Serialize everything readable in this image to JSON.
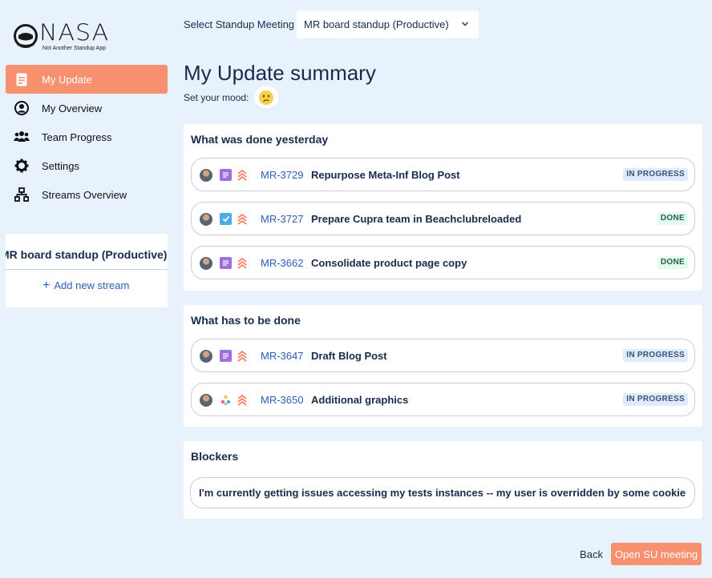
{
  "app": {
    "logo_text": "NASA",
    "logo_tagline": "Not Another Standup App"
  },
  "sidebar": {
    "items": [
      {
        "label": "My Update",
        "icon": "document-icon",
        "active": true
      },
      {
        "label": "My Overview",
        "icon": "user-circle-icon",
        "active": false
      },
      {
        "label": "Team Progress",
        "icon": "team-icon",
        "active": false
      },
      {
        "label": "Settings",
        "icon": "gear-icon",
        "active": false
      },
      {
        "label": "Streams Overview",
        "icon": "hierarchy-icon",
        "active": false
      }
    ],
    "stream": {
      "title": "MR board standup (Productive) live",
      "add_label": "Add new stream"
    }
  },
  "header": {
    "select_label": "Select Standup Meeting",
    "select_value": "MR board standup (Productive)"
  },
  "main": {
    "title": "My Update summary",
    "mood_label": "Set your mood:",
    "mood_icon": "confused-face-icon",
    "yesterday": {
      "title": "What was done yesterday",
      "issues": [
        {
          "key": "MR-3729",
          "summary": "Repurpose Meta-Inf Blog Post",
          "status": "IN PROGRESS",
          "type": "story-icon"
        },
        {
          "key": "MR-3727",
          "summary": "Prepare Cupra team in Beachclubreloaded",
          "status": "DONE",
          "type": "task-icon"
        },
        {
          "key": "MR-3662",
          "summary": "Consolidate product page copy",
          "status": "DONE",
          "type": "story-icon"
        }
      ]
    },
    "todo": {
      "title": "What has to be done",
      "issues": [
        {
          "key": "MR-3647",
          "summary": "Draft Blog Post",
          "status": "IN PROGRESS",
          "type": "story-icon"
        },
        {
          "key": "MR-3650",
          "summary": "Additional graphics",
          "status": "IN PROGRESS",
          "type": "design-icon"
        }
      ]
    },
    "blockers": {
      "title": "Blockers",
      "text": "I'm currently getting issues accessing my tests instances -- my user is overridden by some cookie"
    }
  },
  "footer": {
    "back_label": "Back",
    "open_label": "Open SU meeting"
  },
  "colors": {
    "accent": "#f7906f",
    "background": "#e8f2fc",
    "link": "#2d5eb8",
    "story": "#9f6fe0",
    "task": "#4bade8"
  }
}
